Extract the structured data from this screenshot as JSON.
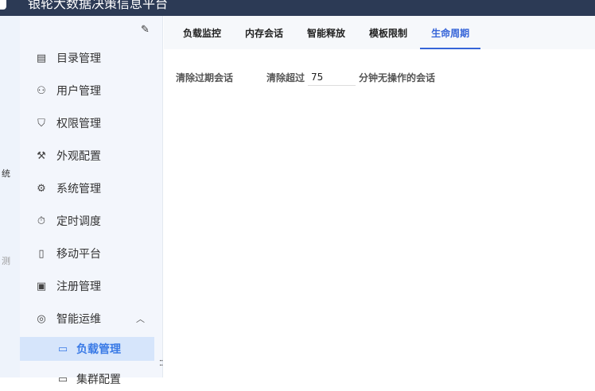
{
  "header": {
    "title": "银轮大数据决策信息平台"
  },
  "left_strip": {
    "items": [
      "统",
      "测"
    ]
  },
  "sidebar": {
    "items": [
      {
        "label": "目录管理",
        "icon": "catalog-icon"
      },
      {
        "label": "用户管理",
        "icon": "user-icon"
      },
      {
        "label": "权限管理",
        "icon": "shield-icon"
      },
      {
        "label": "外观配置",
        "icon": "paint-roller-icon"
      },
      {
        "label": "系统管理",
        "icon": "gear-icon"
      },
      {
        "label": "定时调度",
        "icon": "stopwatch-icon"
      },
      {
        "label": "移动平台",
        "icon": "mobile-icon"
      },
      {
        "label": "注册管理",
        "icon": "register-icon"
      },
      {
        "label": "智能运维",
        "icon": "ops-icon"
      },
      {
        "label": "负载管理",
        "icon": "load-icon"
      },
      {
        "label": "集群配置",
        "icon": "cluster-icon"
      }
    ]
  },
  "tabs": [
    "负载监控",
    "内存会话",
    "智能释放",
    "模板限制",
    "生命周期"
  ],
  "content": {
    "section_label": "清除过期会话",
    "prefix": "清除超过",
    "minutes": "75",
    "suffix": "分钟无操作的会话"
  }
}
